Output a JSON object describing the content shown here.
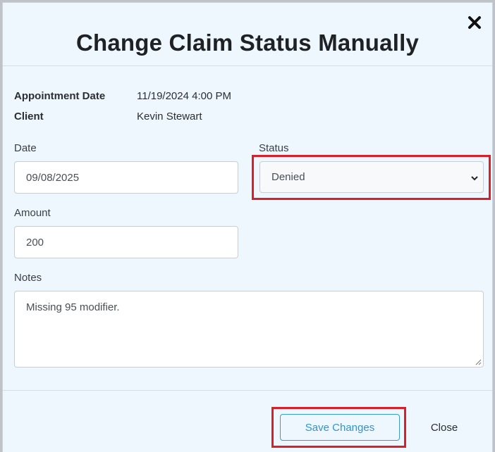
{
  "modal": {
    "title": "Change Claim Status Manually",
    "close_icon": "close-x-icon"
  },
  "info": {
    "appointment_date_label": "Appointment Date",
    "appointment_date_value": "11/19/2024 4:00 PM",
    "client_label": "Client",
    "client_value": "Kevin Stewart"
  },
  "form": {
    "date_label": "Date",
    "date_value": "09/08/2025",
    "status_label": "Status",
    "status_value": "Denied",
    "amount_label": "Amount",
    "amount_value": "200",
    "notes_label": "Notes",
    "notes_value": "Missing 95 modifier."
  },
  "footer": {
    "save_label": "Save Changes",
    "close_label": "Close"
  },
  "colors": {
    "modal_bg": "#eef6fe",
    "accent": "#2f95cf",
    "highlight": "#d9202a"
  }
}
